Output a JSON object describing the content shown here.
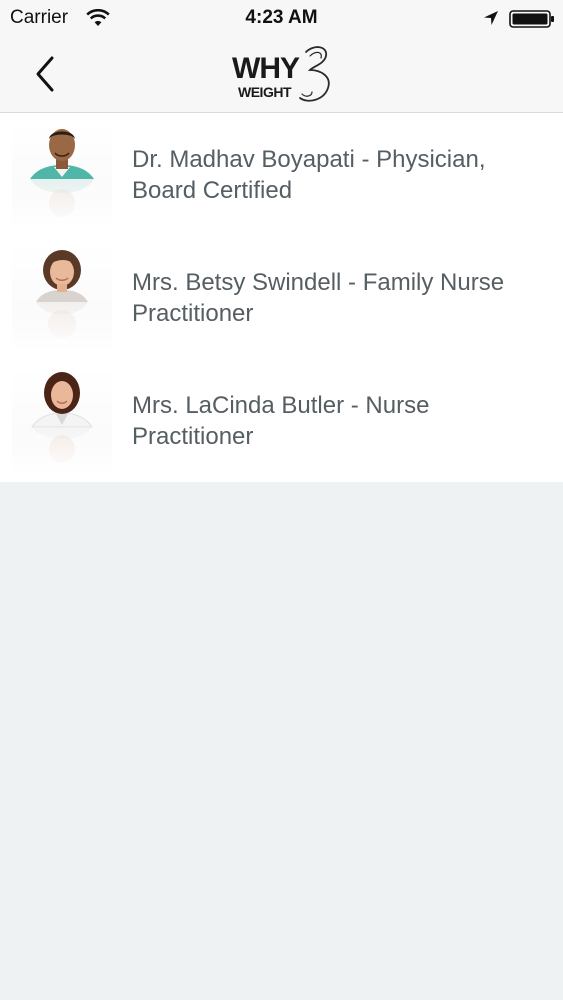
{
  "status_bar": {
    "carrier": "Carrier",
    "time": "4:23 AM",
    "icons": [
      "wifi-icon",
      "location-arrow-icon",
      "battery-icon"
    ]
  },
  "nav_bar": {
    "back_icon": "chevron-left-icon",
    "logo": {
      "line1": "WHY",
      "line2": "WEIGHT"
    }
  },
  "providers": [
    {
      "name": "Dr. Madhav Boyapati - Physician, Board Certified",
      "photo": "male-physician-avatar"
    },
    {
      "name": "Mrs. Betsy Swindell - Family Nurse Practitioner",
      "photo": "female-practitioner-avatar"
    },
    {
      "name": "Mrs. LaCinda Butler - Nurse Practitioner",
      "photo": "female-practitioner-avatar"
    }
  ],
  "colors": {
    "background": "#eef2f3",
    "bar_background": "#f7f7f7",
    "row_background": "#ffffff",
    "text": "#555e63"
  }
}
